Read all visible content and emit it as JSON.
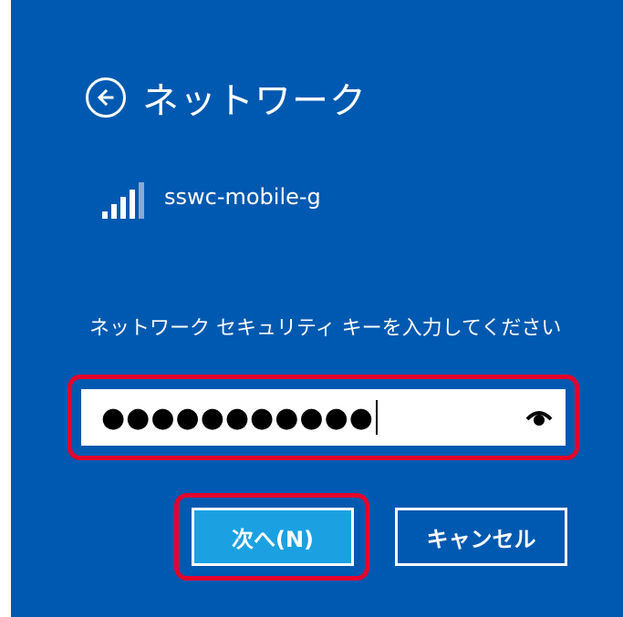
{
  "header": {
    "title": "ネットワーク",
    "back_icon": "back-arrow-circle-icon"
  },
  "network": {
    "name": "sswc-mobile-g",
    "signal_icon": "wifi-signal-icon"
  },
  "prompt": {
    "text": "ネットワーク セキュリティ キーを入力してください"
  },
  "password": {
    "value": "●●●●●●●●●●●",
    "reveal_icon": "reveal-password-icon"
  },
  "buttons": {
    "next_label": "次へ(N)",
    "cancel_label": "キャンセル"
  },
  "colors": {
    "panel_background": "#0059b0",
    "next_button": "#1ba1e2",
    "highlight": "#e5002b"
  }
}
